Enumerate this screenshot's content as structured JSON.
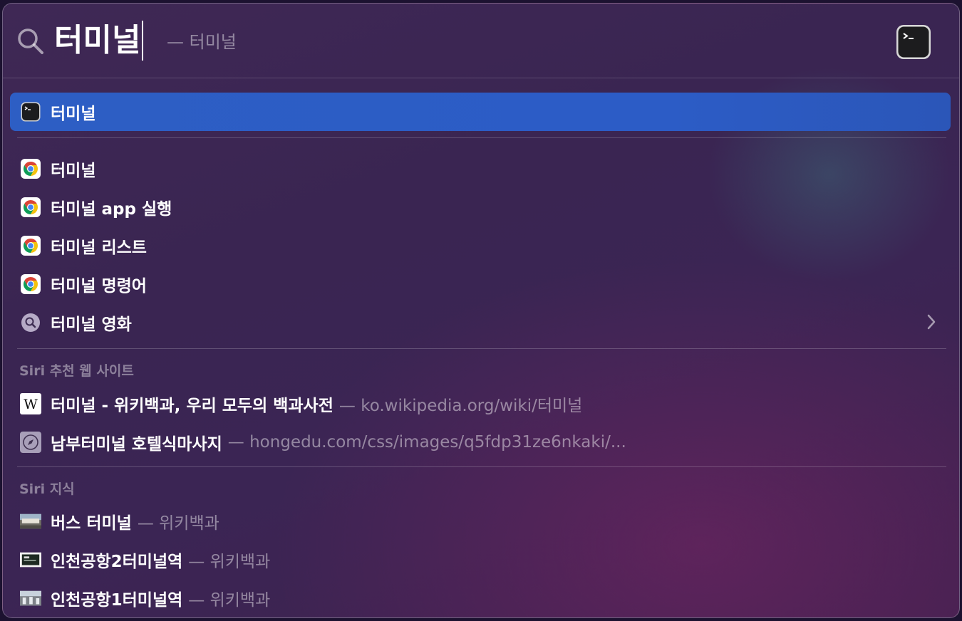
{
  "search": {
    "query": "터미널",
    "suggestion": "— 터미널"
  },
  "top_hit": {
    "label": "터미널",
    "icon": "terminal-app-icon"
  },
  "web_suggestions": [
    {
      "label": "터미널",
      "icon": "chrome-icon"
    },
    {
      "label": "터미널 app 실행",
      "icon": "chrome-icon"
    },
    {
      "label": "터미널 리스트",
      "icon": "chrome-icon"
    },
    {
      "label": "터미널 명령어",
      "icon": "chrome-icon"
    },
    {
      "label": "터미널 영화",
      "icon": "search-icon",
      "has_chevron": true
    }
  ],
  "siri_websites": {
    "header": "Siri 추천 웹 사이트",
    "items": [
      {
        "label": "터미널 - 위키백과, 우리 모두의 백과사전",
        "sub": "— ko.wikipedia.org/wiki/터미널",
        "icon": "wikipedia-icon"
      },
      {
        "label": "남부터미널 호텔식마사지",
        "sub": "— hongedu.com/css/images/q5fdp31ze6nkaki/...",
        "icon": "safari-compass-icon"
      }
    ]
  },
  "siri_knowledge": {
    "header": "Siri 지식",
    "items": [
      {
        "label": "버스 터미널",
        "sub": "— 위키백과",
        "icon": "thumbnail-image-icon"
      },
      {
        "label": "인천공항2터미널역",
        "sub": "— 위키백과",
        "icon": "thumbnail-image-icon"
      },
      {
        "label": "인천공항1터미널역",
        "sub": "— 위키백과",
        "icon": "thumbnail-image-icon"
      }
    ]
  },
  "colors": {
    "selection": "#2d5ec4",
    "panel": "#3b2554",
    "chrome_red": "#db4437",
    "chrome_yellow": "#f4c20d",
    "chrome_green": "#0f9d58",
    "chrome_blue": "#4285f4"
  }
}
